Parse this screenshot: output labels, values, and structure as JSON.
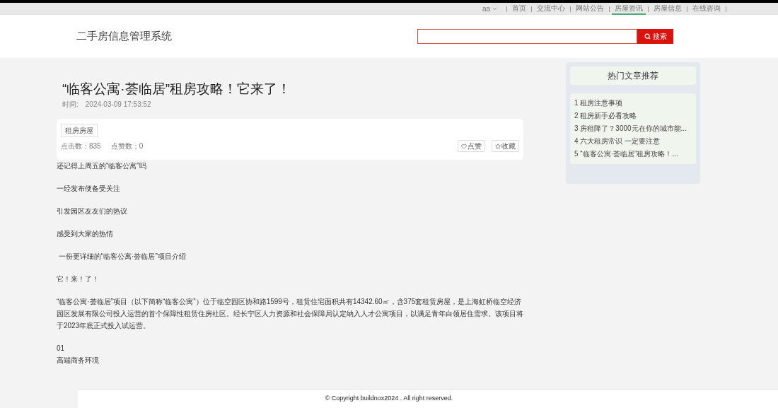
{
  "top_nav": {
    "user": "aa",
    "links": [
      {
        "label": "首页",
        "selected": false
      },
      {
        "label": "交流中心",
        "selected": false
      },
      {
        "label": "网站公告",
        "selected": false
      },
      {
        "label": "房屋资讯",
        "selected": true
      },
      {
        "label": "房屋信息",
        "selected": false
      },
      {
        "label": "在线咨询",
        "selected": false
      }
    ]
  },
  "header": {
    "site_title": "二手房信息管理系统",
    "search_button": "搜索"
  },
  "article": {
    "title": "“临客公寓·荟临居”租房攻略！它来了！",
    "time_label": "时间:",
    "time": "2024-03-09 17:53:52",
    "tag": "租房房屋",
    "clicks": "点击数：835",
    "likes": "点赞数：0",
    "like_button": "点赞",
    "favorite_button": "收藏",
    "paragraphs": [
      {
        "lines": [
          "还记得上周五的“临客公寓”吗"
        ]
      },
      {
        "lines": [
          "一经发布便备受关注"
        ]
      },
      {
        "lines": [
          "引发园区友友们的热议"
        ]
      },
      {
        "lines": [
          "感受到大家的热情"
        ]
      },
      {
        "lines": [
          " 一份更详细的“临客公寓·荟临居”项目介绍"
        ]
      },
      {
        "lines": [
          "它！来！了！"
        ]
      },
      {
        "lines": [
          "“临客公寓·荟临居”项目（以下简称“临客公寓”）位于临空园区协和路1599号，租赁住宅面积共有14342.60㎡，含375套租赁房屋，是上海虹桥临空经济园区发展有限公司投入运营的首个保障性租赁住房社区。经长宁区人力资源和社会保障局认定纳入人才公寓项目，以满足青年白领居住需求。该项目将于2023年底正式投入试运营。"
        ]
      },
      {
        "lines": [
          "01",
          "高端商务环境"
        ]
      }
    ]
  },
  "sidebar": {
    "title": "热门文章推荐",
    "items": [
      "1 租房注意事项",
      "2 租房新手必看攻略",
      "3 房租降了？3000元在你的城市能...",
      "4 六大租房常识 一定要注意",
      "5 “临客公寓·荟临居”租房攻略！..."
    ]
  },
  "footer": "© Copyright buildnox2024 . All right reserved."
}
